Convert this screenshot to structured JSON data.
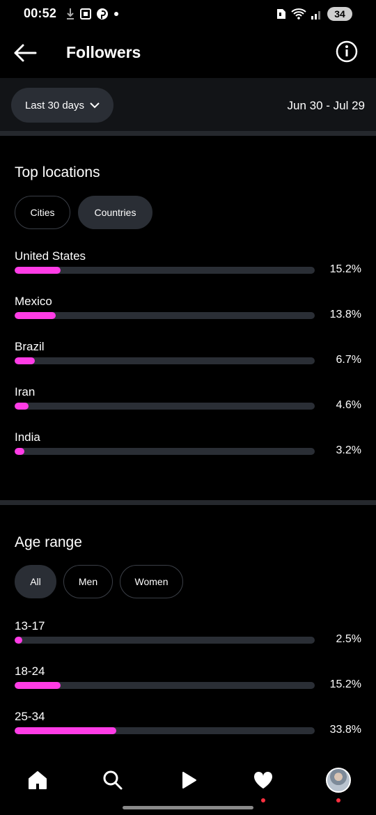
{
  "status_bar": {
    "time": "00:52",
    "battery": "34"
  },
  "header": {
    "title": "Followers",
    "back_icon": "arrow-left-icon",
    "info_icon": "info-icon"
  },
  "filter": {
    "range_label": "Last 30 days",
    "date_range": "Jun 30 - Jul 29"
  },
  "accent_color": "#ff3ce6",
  "top_locations": {
    "title": "Top locations",
    "tabs": [
      {
        "label": "Cities",
        "active": false
      },
      {
        "label": "Countries",
        "active": true
      }
    ],
    "rows": [
      {
        "label": "United States",
        "value_text": "15.2%",
        "value": 15.2
      },
      {
        "label": "Mexico",
        "value_text": "13.8%",
        "value": 13.8
      },
      {
        "label": "Brazil",
        "value_text": "6.7%",
        "value": 6.7
      },
      {
        "label": "Iran",
        "value_text": "4.6%",
        "value": 4.6
      },
      {
        "label": "India",
        "value_text": "3.2%",
        "value": 3.2
      }
    ]
  },
  "age_range": {
    "title": "Age range",
    "tabs": [
      {
        "label": "All",
        "active": true
      },
      {
        "label": "Men",
        "active": false
      },
      {
        "label": "Women",
        "active": false
      }
    ],
    "rows": [
      {
        "label": "13-17",
        "value_text": "2.5%",
        "value": 2.5
      },
      {
        "label": "18-24",
        "value_text": "15.2%",
        "value": 15.2
      },
      {
        "label": "25-34",
        "value_text": "33.8%",
        "value": 33.8
      }
    ]
  },
  "bottom_nav": [
    "home-icon",
    "search-icon",
    "reels-icon",
    "activity-heart-icon",
    "profile-avatar"
  ]
}
